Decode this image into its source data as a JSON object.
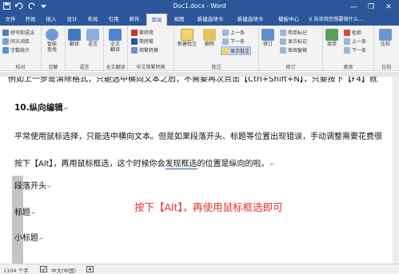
{
  "window": {
    "title": "Doc1.docx - Word",
    "minimize_glyph": "—",
    "restore_glyph": "❐",
    "close_glyph": "✕"
  },
  "quick_access": {
    "save_icon": "save-icon",
    "undo_icon": "undo-icon",
    "redo_icon": "redo-icon",
    "customize_icon": "customize-icon"
  },
  "tabs": [
    "文件",
    "开始",
    "插入",
    "设计",
    "布局",
    "引用",
    "邮件",
    "审阅",
    "视图",
    "新建选项卡",
    "新建选项卡",
    "模板中心"
  ],
  "active_tab": "审阅",
  "tell_me": "♀ 告诉我您想要做什么...",
  "ribbon": {
    "proofing": {
      "label": "校对",
      "items": [
        "拼写和语法",
        "同义词库",
        "字数统计"
      ]
    },
    "insights": {
      "label": "见解",
      "items": [
        "智能",
        "查找"
      ]
    },
    "language": {
      "label": "语言",
      "items": [
        "翻译",
        "语言"
      ]
    },
    "fulltext": {
      "label": "全文翻译",
      "items": [
        "全文",
        "翻译"
      ]
    },
    "chinese": {
      "label": "中文简繁转换",
      "items": [
        "繁转简",
        "简转繁",
        "简繁转换"
      ]
    },
    "comments": {
      "label": "批注",
      "items": [
        "新建批注",
        "删除",
        "上一条",
        "下一条",
        "显示批注"
      ]
    },
    "tracking": {
      "label": "修订",
      "items": [
        "修订",
        "简单标记",
        "显示标记",
        "审阅窗格"
      ]
    },
    "changes": {
      "label": "更改",
      "items": [
        "接受",
        "拒绝",
        "上一条",
        "下一条"
      ]
    },
    "compare": {
      "label": "比较",
      "items": [
        "比较"
      ]
    }
  },
  "document": {
    "line1": "例如上一步是清除格式，只能选中横向文本之后，不需要再次点击【Ctrl+Shift+N】，只要按下【F4】就",
    "heading": "10.纵向编辑",
    "para1": "平常使用鼠标选择，只能选中横向文本。但是如果段落开头、标题等位置出现错误，手动调整需要花费很",
    "para2_a": "按下【Alt】，再用鼠标框选，这个时候你会",
    "para2_b": "发现框选",
    "para2_c": "的位置是纵向的啦。",
    "item1": "段落开头",
    "item2": "标题",
    "item3": "小标题",
    "paragraph_mark": "↵",
    "hint": "按下【Alt】，再使用鼠标框选即可"
  },
  "status": {
    "words": "1104 个字",
    "lang_icon": "proofing-icon",
    "language": "中文(中国)",
    "record_icon": "macro-icon"
  }
}
